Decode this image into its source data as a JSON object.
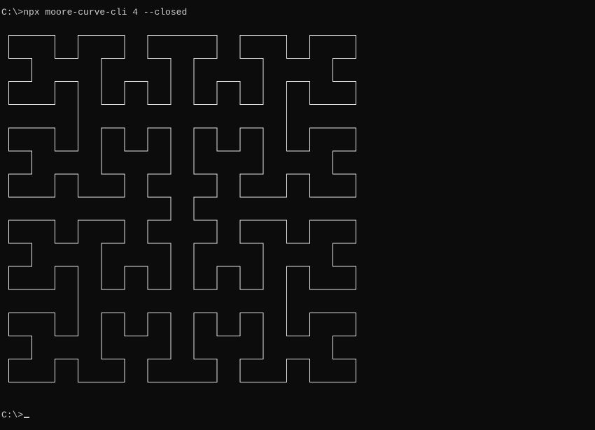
{
  "terminal": {
    "command_prompt": "C:\\>",
    "command": "npx moore-curve-cli 4 --closed",
    "final_prompt": "C:\\>",
    "foreground": "#cccccc",
    "background": "#0c0c0c"
  },
  "output": {
    "type": "moore-curve",
    "order": 4,
    "closed": true
  }
}
